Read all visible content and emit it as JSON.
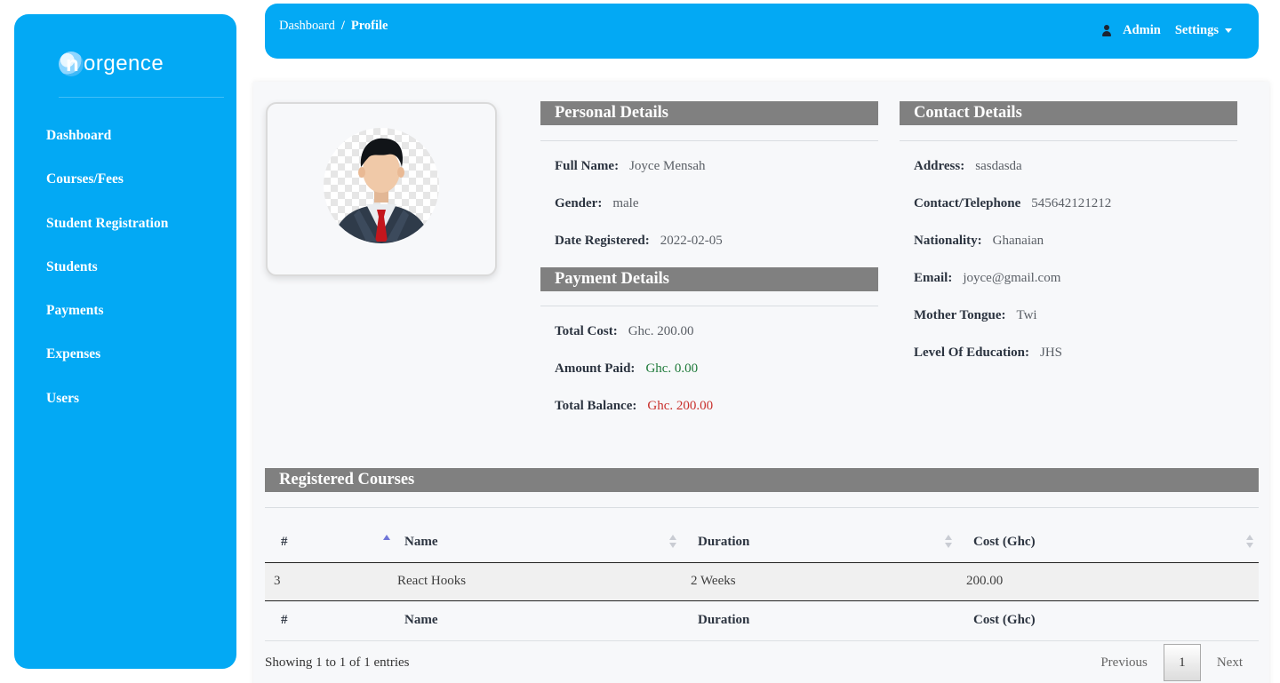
{
  "brand": {
    "mark_letter": "n",
    "text": "orgence"
  },
  "sidebar": {
    "items": [
      {
        "label": "Dashboard"
      },
      {
        "label": "Courses/Fees"
      },
      {
        "label": "Student Registration"
      },
      {
        "label": "Students"
      },
      {
        "label": "Payments"
      },
      {
        "label": "Expenses"
      },
      {
        "label": "Users"
      }
    ]
  },
  "topbar": {
    "breadcrumb": {
      "parent": "Dashboard",
      "separator": "/",
      "current": "Profile"
    },
    "user_label": "Admin",
    "settings_label": "Settings"
  },
  "personal": {
    "title": "Personal Details",
    "full_name": {
      "label": "Full Name:",
      "value": "Joyce Mensah"
    },
    "gender": {
      "label": "Gender:",
      "value": "male"
    },
    "date_registered": {
      "label": "Date Registered:",
      "value": "2022-02-05"
    }
  },
  "payment": {
    "title": "Payment Details",
    "total_cost": {
      "label": "Total Cost:",
      "value": "Ghc. 200.00"
    },
    "amount_paid": {
      "label": "Amount Paid:",
      "value": "Ghc. 0.00"
    },
    "total_balance": {
      "label": "Total Balance:",
      "value": "Ghc. 200.00"
    }
  },
  "contact": {
    "title": "Contact Details",
    "address": {
      "label": "Address:",
      "value": "sasdasda"
    },
    "telephone": {
      "label": "Contact/Telephone",
      "value": "545642121212"
    },
    "nationality": {
      "label": "Nationality:",
      "value": "Ghanaian"
    },
    "email": {
      "label": "Email:",
      "value": "joyce@gmail.com"
    },
    "mother_tongue": {
      "label": "Mother Tongue:",
      "value": "Twi"
    },
    "education": {
      "label": "Level Of Education:",
      "value": "JHS"
    }
  },
  "courses": {
    "title": "Registered Courses",
    "columns": [
      "#",
      "Name",
      "Duration",
      "Cost (Ghc)"
    ],
    "rows": [
      [
        "3",
        "React Hooks",
        "2 Weeks",
        "200.00"
      ]
    ],
    "info": "Showing 1 to 1 of 1 entries",
    "pagination": {
      "previous": "Previous",
      "current_page": "1",
      "next": "Next"
    }
  },
  "colors": {
    "primary": "#03a9f4",
    "section_header": "#808080",
    "paid": "#1f7a3a",
    "balance": "#c9302c"
  },
  "icons": {
    "user": "user-icon",
    "settings_caret": "caret-down-icon",
    "avatar": "businessman-avatar"
  }
}
